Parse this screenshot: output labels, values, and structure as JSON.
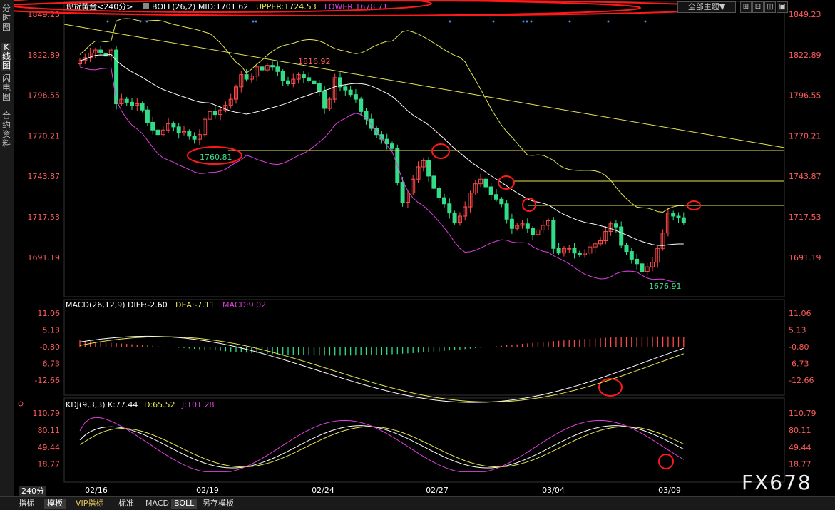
{
  "sidebar": [
    {
      "label": "分时图",
      "active": false
    },
    {
      "label": "K线图",
      "active": true
    },
    {
      "label": "闪电图",
      "active": false
    },
    {
      "label": "合约资料",
      "active": false
    }
  ],
  "toolbar": {
    "theme_label": "全部主题▼",
    "ctl_icons": [
      "⊞",
      "⊟",
      "◫",
      "▣",
      "⊠"
    ]
  },
  "header": {
    "instrument": "现货黄金",
    "period": "<240分>",
    "boll_label": "BOLL(26,2)",
    "mid": "MID:1701.62",
    "upper": "UPPER:1724.53",
    "lower": "LOWER:1678.71"
  },
  "macd_header": {
    "label": "MACD(26,12,9)",
    "diff": "DIFF:-2.60",
    "dea": "DEA:-7.11",
    "macd": "MACD:9.02"
  },
  "kdj_header": {
    "label": "KDJ(9,3,3)",
    "k": "K:77.44",
    "d": "D:65.52",
    "j": "J:101.28"
  },
  "price_axis": [
    "1849.23",
    "1822.89",
    "1796.55",
    "1770.21",
    "1743.87",
    "1717.53",
    "1691.19"
  ],
  "macd_axis": [
    "11.06",
    "5.13",
    "-0.80",
    "-6.73",
    "-12.66"
  ],
  "kdj_axis": [
    "110.79",
    "80.11",
    "49.44",
    "18.77"
  ],
  "date_labels": [
    "02/16",
    "02/19",
    "02/24",
    "02/27",
    "03/04",
    "03/09"
  ],
  "annotations": {
    "high": "1816.92",
    "low1": "1760.81",
    "low2": "1676.91"
  },
  "period_badge": "240分",
  "bottom_tabs": [
    "指标",
    "模板",
    "VIP指标",
    "标准",
    "MACD",
    "BOLL",
    "另存模板"
  ],
  "watermark": "FX678",
  "colors": {
    "up": "#ff4a4a",
    "down": "#33dd88",
    "mid": "#ffffff",
    "upper": "#e6e650",
    "lower": "#e040e0",
    "diff": "#ffffff",
    "dea": "#e6e650",
    "j": "#e040e0",
    "trend": "#e6e650",
    "circle": "#ff1a1a",
    "axis_text": "#ff5c5c"
  },
  "chart_data": {
    "type": "candlestick",
    "title": "现货黄金 <240分>",
    "ylim": [
      1676,
      1852
    ],
    "closes": [
      1819,
      1821,
      1824,
      1826,
      1824,
      1822,
      1826,
      1791,
      1794,
      1792,
      1790,
      1791,
      1787,
      1779,
      1774,
      1771,
      1774,
      1778,
      1776,
      1772,
      1773,
      1770,
      1768,
      1771,
      1781,
      1786,
      1784,
      1787,
      1790,
      1794,
      1802,
      1810,
      1807,
      1809,
      1815,
      1813,
      1816,
      1815,
      1812,
      1806,
      1804,
      1807,
      1810,
      1808,
      1806,
      1804,
      1799,
      1788,
      1794,
      1808,
      1802,
      1800,
      1797,
      1794,
      1786,
      1781,
      1775,
      1771,
      1768,
      1765,
      1762,
      1740,
      1727,
      1733,
      1742,
      1750,
      1754,
      1744,
      1736,
      1730,
      1726,
      1720,
      1714,
      1718,
      1724,
      1733,
      1739,
      1742,
      1737,
      1732,
      1729,
      1726,
      1716,
      1710,
      1712,
      1713,
      1710,
      1706,
      1709,
      1712,
      1715,
      1697,
      1694,
      1697,
      1697,
      1694,
      1693,
      1694,
      1698,
      1700,
      1702,
      1708,
      1713,
      1711,
      1699,
      1695,
      1690,
      1687,
      1682,
      1685,
      1688,
      1697,
      1707,
      1720,
      1718,
      1717,
      1714
    ]
  }
}
